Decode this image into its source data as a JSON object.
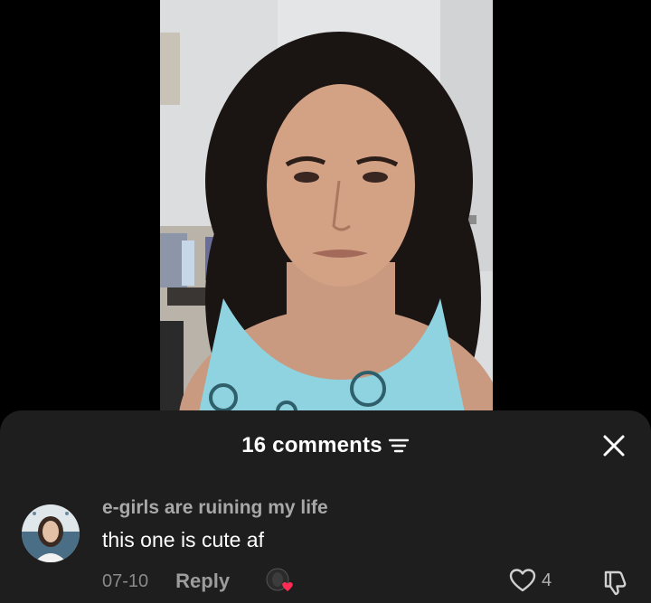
{
  "video": {
    "description_icon": "selfie-video-frame"
  },
  "comments_panel": {
    "title": "16 comments",
    "filter_icon": "filter-icon",
    "close_icon": "close-icon"
  },
  "comments": [
    {
      "username": "e-girls are ruining my life",
      "text": "this one is cute af",
      "date": "07-10",
      "reply_label": "Reply",
      "like_count": "4"
    }
  ],
  "colors": {
    "sheet_background": "#1e1e1e",
    "liked_by_creator_heart": "#fe2c55"
  }
}
